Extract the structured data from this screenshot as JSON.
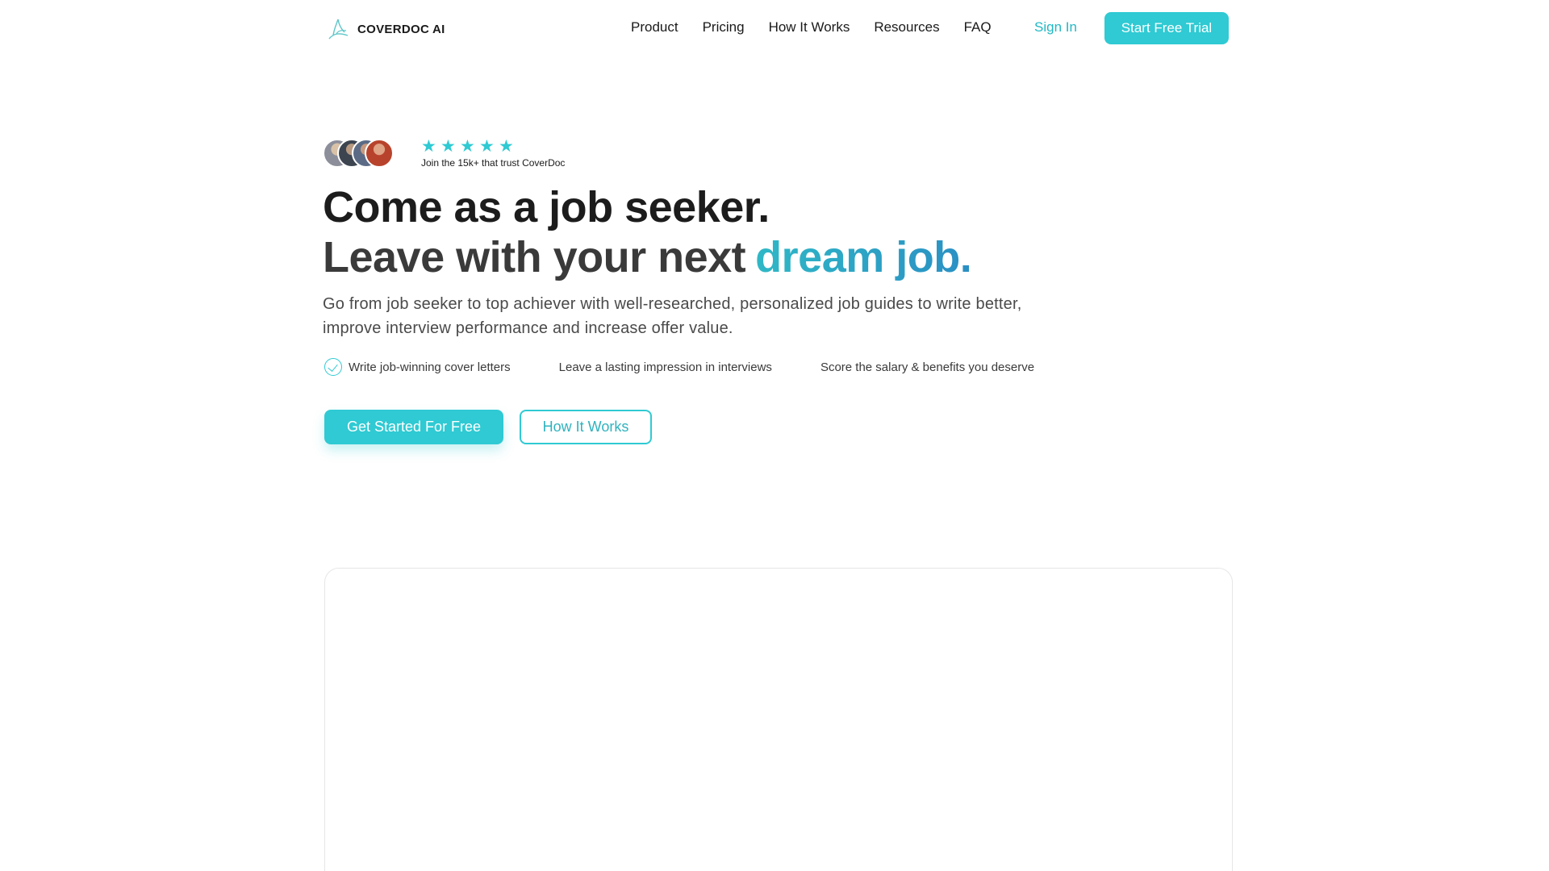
{
  "brand": {
    "name": "COVERDOC AI"
  },
  "nav": {
    "links": [
      "Product",
      "Pricing",
      "How It Works",
      "Resources",
      "FAQ"
    ],
    "sign_in": "Sign In",
    "trial": "Start Free Trial"
  },
  "proof": {
    "stars": 5,
    "text": "Join the 15k+ that trust CoverDoc"
  },
  "hero": {
    "line1": "Come as a job seeker.",
    "line2": "Leave with your next",
    "accent": "dream job.",
    "subtitle": "Go from job seeker to top achiever with well-researched, personalized job guides to write better, improve interview performance and increase offer value.",
    "features": [
      "Write job-winning cover letters",
      "Leave a lasting impression in interviews",
      "Score the salary & benefits you deserve"
    ],
    "primary_cta": "Get Started For Free",
    "secondary_cta": "How It Works"
  },
  "colors": {
    "accent": "#2fcad3",
    "accent_dark": "#2a8fc4"
  }
}
